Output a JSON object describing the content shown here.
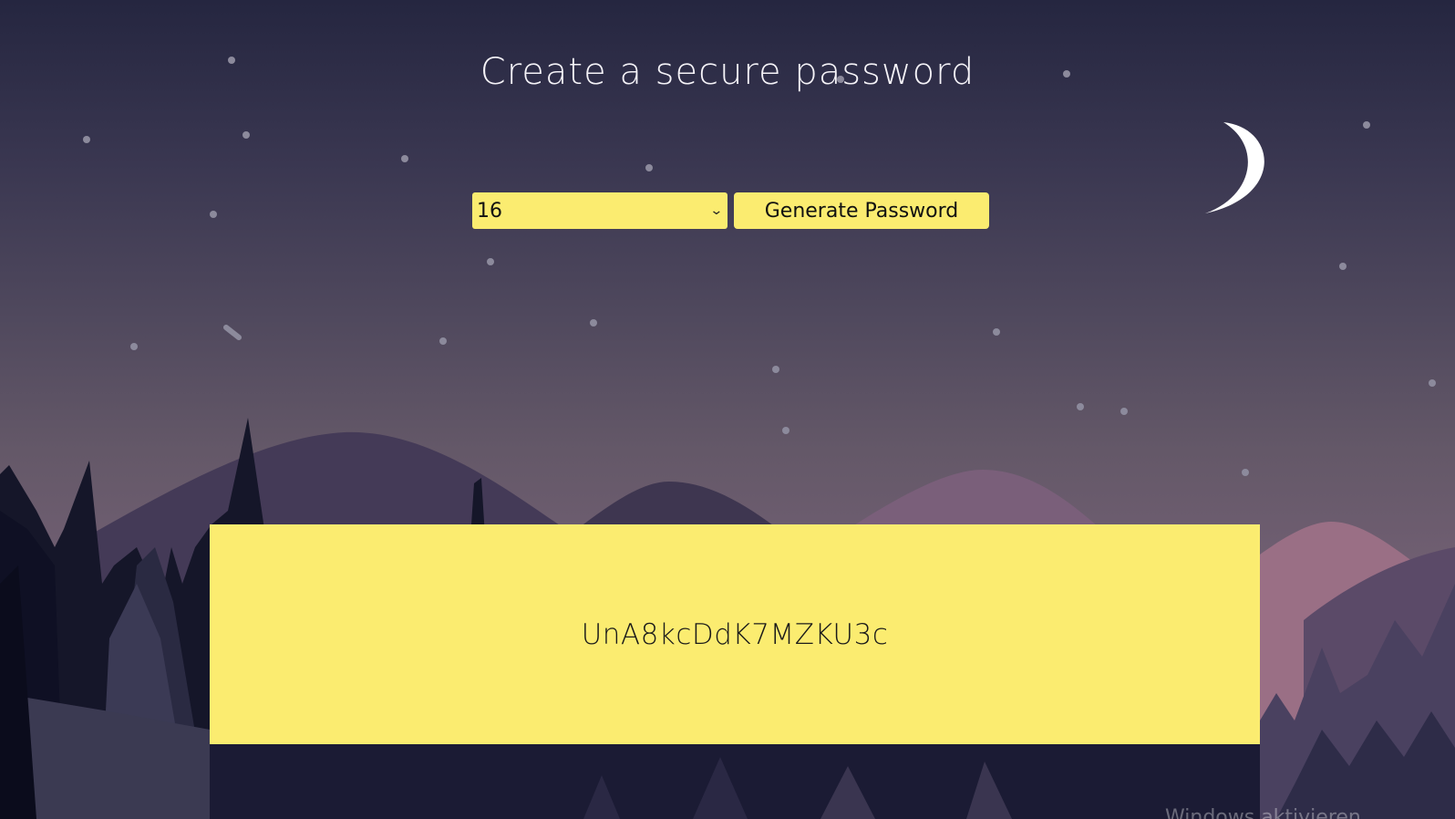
{
  "page": {
    "title": "Create a secure password"
  },
  "controls": {
    "length_select": {
      "selected_value": "16"
    },
    "generate_button_label": "Generate Password"
  },
  "result": {
    "password": "UnA8kcDdK7MZKU3c"
  },
  "background": {
    "scene": "night mountain forest with stars",
    "moon_icon": "crescent-moon",
    "accent_color": "#fbec70"
  },
  "watermark": {
    "text": "Windows aktivieren"
  }
}
